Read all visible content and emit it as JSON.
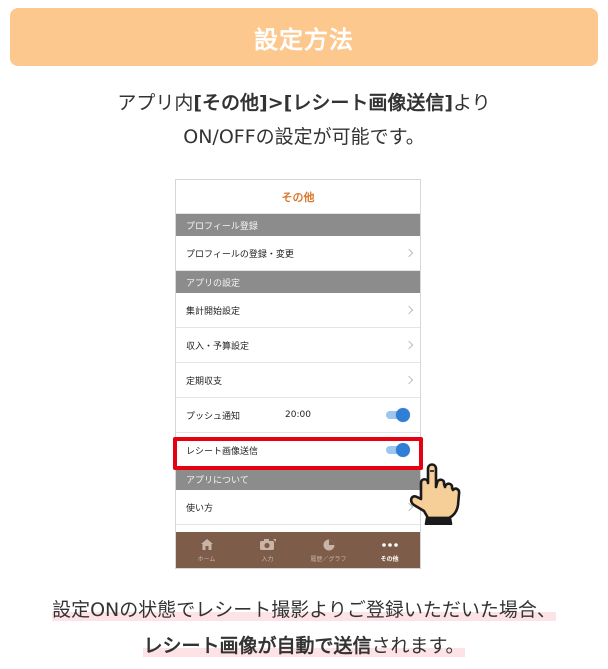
{
  "header": {
    "title": "設定方法"
  },
  "intro": {
    "line1_prefix": "アプリ内",
    "line1_path": "[その他]>[レシート画像送信]",
    "line1_suffix": "より",
    "line2": "ON/OFFの設定が可能です。"
  },
  "phone": {
    "title": "その他",
    "sections": [
      {
        "label": "プロフィール登録",
        "rows": [
          "プロフィールの登録・変更"
        ]
      },
      {
        "label": "アプリの設定",
        "rows": [
          "集計開始設定",
          "収入・予算設定",
          "定期収支"
        ]
      }
    ],
    "push": {
      "label": "プッシュ通知",
      "time": "20:00",
      "on": true
    },
    "receipt": {
      "label": "レシート画像送信",
      "on": true
    },
    "about": {
      "label": "アプリについて",
      "rows": [
        "使い方"
      ]
    },
    "tabs": [
      {
        "label": "ホーム",
        "icon": "home-icon"
      },
      {
        "label": "入力",
        "icon": "camera-icon"
      },
      {
        "label": "履歴／グラフ",
        "icon": "pie-chart-icon"
      },
      {
        "label": "その他",
        "icon": "more-icon",
        "active": true
      }
    ]
  },
  "outro": {
    "line1": "設定ONの状態でレシート撮影よりご登録いただいた場合、",
    "line2_bold1": "レシート画像が自動で送信",
    "line2_rest": "されます。"
  },
  "colors": {
    "banner": "#fcc88e",
    "accent_orange": "#d9772d",
    "highlight_red": "#e50012",
    "toggle_blue": "#2f7fd6",
    "tabbar_brown": "#7d5c4a"
  }
}
